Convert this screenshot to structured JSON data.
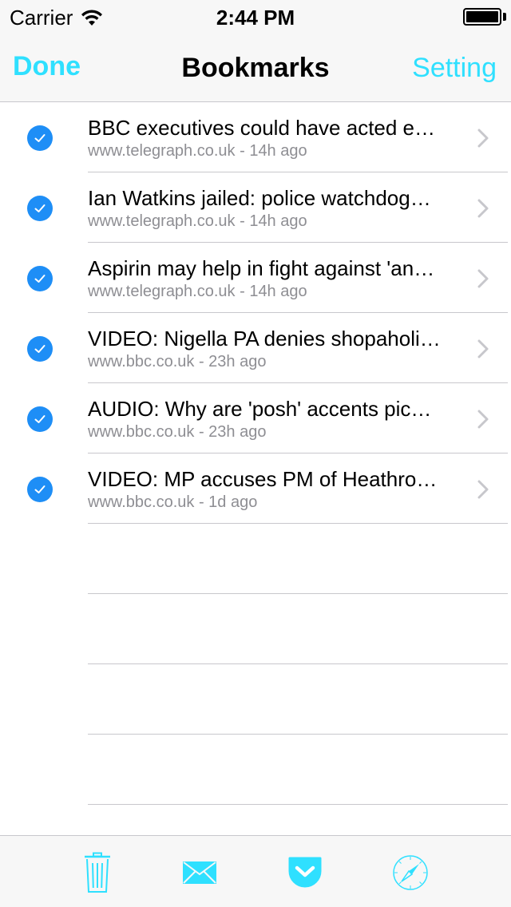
{
  "status_bar": {
    "carrier": "Carrier",
    "time": "2:44 PM",
    "battery_level": 1.0
  },
  "nav": {
    "left_label": "Done",
    "title": "Bookmarks",
    "right_label": "Setting",
    "accent_color": "#2fe0ff"
  },
  "bookmarks": [
    {
      "title": "BBC executives could have acted e…",
      "subtitle": "www.telegraph.co.uk - 14h ago",
      "checked": true
    },
    {
      "title": "Ian Watkins jailed: police watchdog…",
      "subtitle": "www.telegraph.co.uk - 14h ago",
      "checked": true
    },
    {
      "title": "Aspirin may help in fight against 'an…",
      "subtitle": "www.telegraph.co.uk - 14h ago",
      "checked": true
    },
    {
      "title": "VIDEO: Nigella PA denies shopaholi…",
      "subtitle": "www.bbc.co.uk - 23h ago",
      "checked": true
    },
    {
      "title": "AUDIO: Why are 'posh' accents pic…",
      "subtitle": "www.bbc.co.uk - 23h ago",
      "checked": true
    },
    {
      "title": "VIDEO: MP accuses PM of Heathro…",
      "subtitle": "www.bbc.co.uk - 1d ago",
      "checked": true
    }
  ],
  "check_color": "#1e8ef6",
  "toolbar": {
    "icons": [
      "trash-icon",
      "mail-icon",
      "pocket-icon",
      "compass-icon"
    ]
  }
}
